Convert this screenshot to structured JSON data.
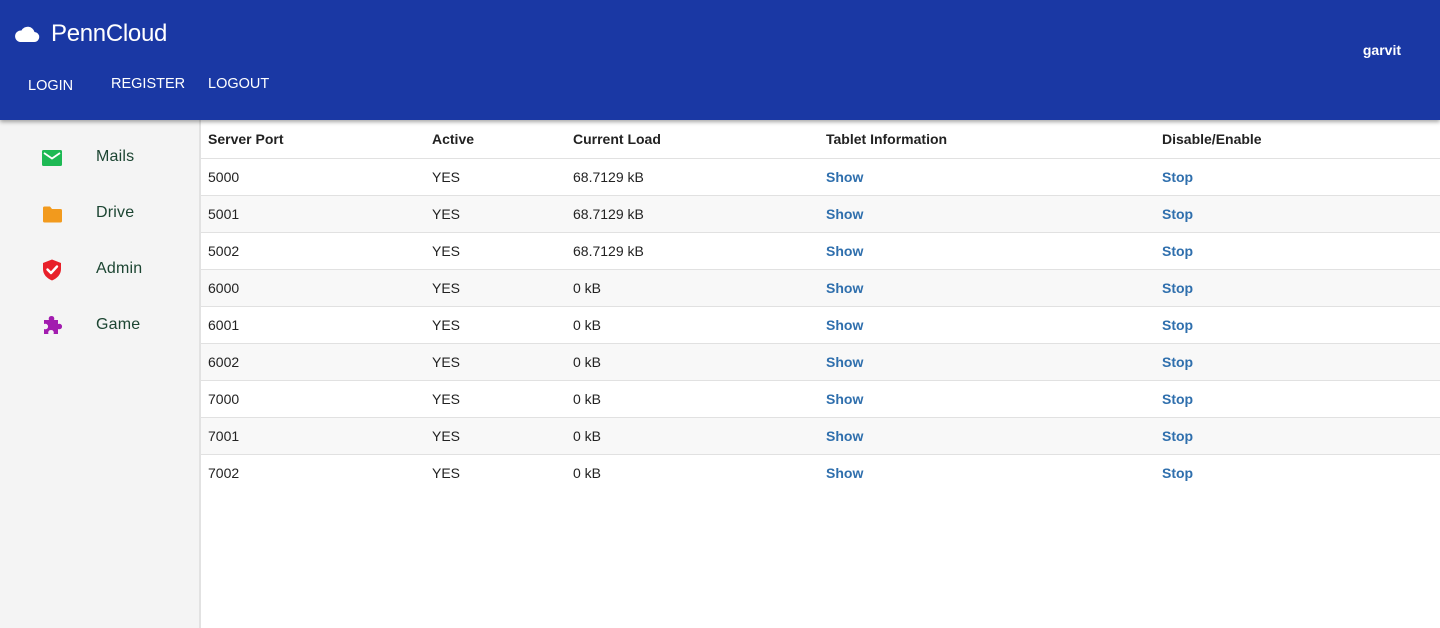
{
  "header": {
    "brand": "PennCloud",
    "user": "garvit",
    "nav": {
      "login": "LOGIN",
      "register": "REGISTER",
      "logout": "LOGOUT"
    },
    "colors": {
      "bar": "#1a38a4"
    }
  },
  "sidebar": {
    "items": [
      {
        "label": "Mails",
        "icon": "mail-icon",
        "color": "#1db954"
      },
      {
        "label": "Drive",
        "icon": "folder-icon",
        "color": "#f29a1d"
      },
      {
        "label": "Admin",
        "icon": "shield-check-icon",
        "color": "#e8202a"
      },
      {
        "label": "Game",
        "icon": "puzzle-icon",
        "color": "#a21caf"
      }
    ]
  },
  "table": {
    "columns": [
      "Server Port",
      "Active",
      "Current Load",
      "Tablet Information",
      "Disable/Enable"
    ],
    "rows": [
      {
        "port": "5000",
        "active": "YES",
        "load": "68.7129 kB",
        "info": "Show",
        "action": "Stop"
      },
      {
        "port": "5001",
        "active": "YES",
        "load": "68.7129 kB",
        "info": "Show",
        "action": "Stop"
      },
      {
        "port": "5002",
        "active": "YES",
        "load": "68.7129 kB",
        "info": "Show",
        "action": "Stop"
      },
      {
        "port": "6000",
        "active": "YES",
        "load": "0 kB",
        "info": "Show",
        "action": "Stop"
      },
      {
        "port": "6001",
        "active": "YES",
        "load": "0 kB",
        "info": "Show",
        "action": "Stop"
      },
      {
        "port": "6002",
        "active": "YES",
        "load": "0 kB",
        "info": "Show",
        "action": "Stop"
      },
      {
        "port": "7000",
        "active": "YES",
        "load": "0 kB",
        "info": "Show",
        "action": "Stop"
      },
      {
        "port": "7001",
        "active": "YES",
        "load": "0 kB",
        "info": "Show",
        "action": "Stop"
      },
      {
        "port": "7002",
        "active": "YES",
        "load": "0 kB",
        "info": "Show",
        "action": "Stop"
      }
    ]
  }
}
